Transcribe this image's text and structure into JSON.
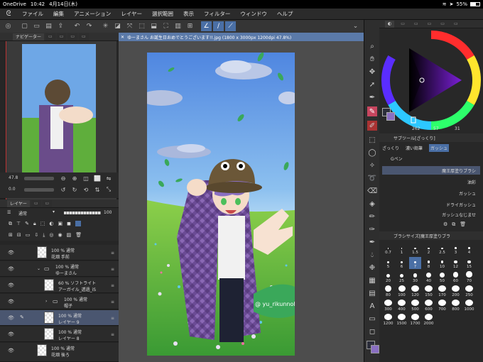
{
  "status": {
    "carrier": "OneDrive",
    "time": "10:42",
    "date": "4月14日(木)",
    "battery": "55%"
  },
  "menu": {
    "items": [
      "ファイル",
      "編集",
      "アニメーション",
      "レイヤー",
      "選択範囲",
      "表示",
      "フィルター",
      "ウィンドウ",
      "ヘルプ"
    ]
  },
  "navigator": {
    "tabs": [
      "ナビゲーター",
      "",
      "",
      "",
      ""
    ],
    "zoom": "47.8",
    "rotation": "0.0"
  },
  "document": {
    "tab_title": "ゆーまさん お誕生日おめでとうございます!!.jpg (1800 x 3000px 1200dpi 47.8%)"
  },
  "layers": {
    "tab_label": "レイヤー",
    "blend_mode": "通常",
    "opacity": "100",
    "rows": [
      {
        "line1": "100 % 通常",
        "line2": "花畑 手前",
        "type": "layer"
      },
      {
        "line1": "100 % 通常",
        "line2": "ゆーまさん",
        "type": "folder"
      },
      {
        "line1": "60 % ソフトライト",
        "line2": "アーガイル_透過_iS",
        "type": "layer"
      },
      {
        "line1": "100 % 通常",
        "line2": "帽子",
        "type": "folder"
      },
      {
        "line1": "100 % 通常",
        "line2": "レイヤー 9",
        "type": "layer"
      },
      {
        "line1": "100 % 通常",
        "line2": "レイヤー 8",
        "type": "layer"
      },
      {
        "line1": "100 % 通常",
        "line2": "花畑 後ろ",
        "type": "layer"
      }
    ]
  },
  "color": {
    "hsv_readout": [
      "262",
      "57",
      "31"
    ]
  },
  "subtool": {
    "title": "サブツール[ざっくり]",
    "groups": [
      "ざっくり",
      "濃い鉛筆",
      "ガッシュ"
    ],
    "group2": "Gペン",
    "brushes": [
      "魔王厚塗りブラシ",
      "油彩",
      "ガッシュ",
      "ドライガッシュ",
      "ガッシュなじませ"
    ]
  },
  "brushsize": {
    "title": "ブラシサイズ[魔王厚塗りブラ",
    "sizes": [
      "0.7",
      "1",
      "1.5",
      "2",
      "2.5",
      "3",
      "4",
      "5",
      "6",
      "7",
      "8",
      "10",
      "12",
      "15",
      "20",
      "25",
      "30",
      "40",
      "50",
      "60",
      "70",
      "80",
      "100",
      "120",
      "150",
      "170",
      "200",
      "250",
      "300",
      "400",
      "500",
      "600",
      "700",
      "800",
      "1000",
      "1200",
      "1500",
      "1700",
      "2000"
    ],
    "selected": "7"
  },
  "art": {
    "signature": "@ yu_rikunnoheta"
  },
  "colors": {
    "accent": "#4a6fa5",
    "doc_tab": "#5b7aa9",
    "selected_layer": "#4a5670"
  }
}
